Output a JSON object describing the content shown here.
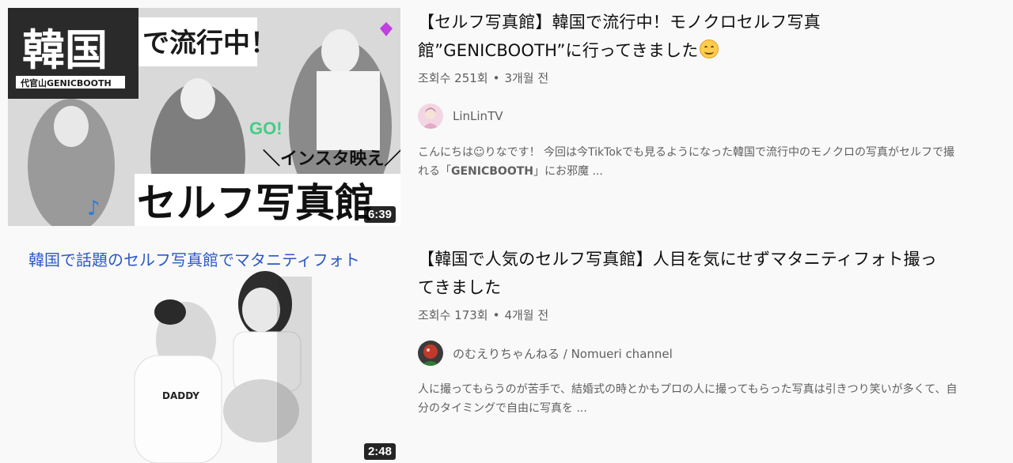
{
  "results": [
    {
      "duration": "6:39",
      "title_line1": "【セルフ写真館】韓国で流行中！モノクロセルフ写真",
      "title_line2": "館”GENICBOOTH”に行ってきました",
      "title_emoji": "smiling-face-emoji",
      "views": "조회수 251회",
      "age": "3개월 전",
      "channel": "LinLinTV",
      "desc_line1": "こんにちは☺りなです！ 今回は今TikTokでも見るようになった韓国で流行中のモノクロの写真がセルフで撮",
      "desc_line2_pre": "れる「",
      "desc_line2_kw": "GENICBOOTH",
      "desc_line2_post": "」にお邪魔 ...",
      "thumb_text": {
        "big1": "韓国",
        "big2": "で流行中！",
        "place": "代官山GENICBOOTH",
        "insta": "＼インスタ映え／",
        "studio": "セルフ写真館",
        "go": "GO!"
      }
    },
    {
      "duration": "2:48",
      "title_line1": "【韓国で人気のセルフ写真館】人目を気にせずマタニティフォト撮っ",
      "title_line2": "てきました",
      "views": "조회수 173회",
      "age": "4개월 전",
      "channel": "のむえりちゃんねる / Nomueri channel",
      "desc_line1": "人に撮ってもらうのが苦手で、結婚式の時とかもプロの人に撮ってもらった写真は引きつり笑いが多くて、自",
      "desc_line2": "分のタイミングで自由に写真を ...",
      "thumb_text": {
        "caption": "韓国で話題のセルフ写真館でマタニティフォト"
      }
    }
  ],
  "colors": {
    "background": "#f9f9f9",
    "title": "#0f0f0f",
    "secondary": "#606060",
    "thumb_caption_blue": "#2b58c9"
  }
}
